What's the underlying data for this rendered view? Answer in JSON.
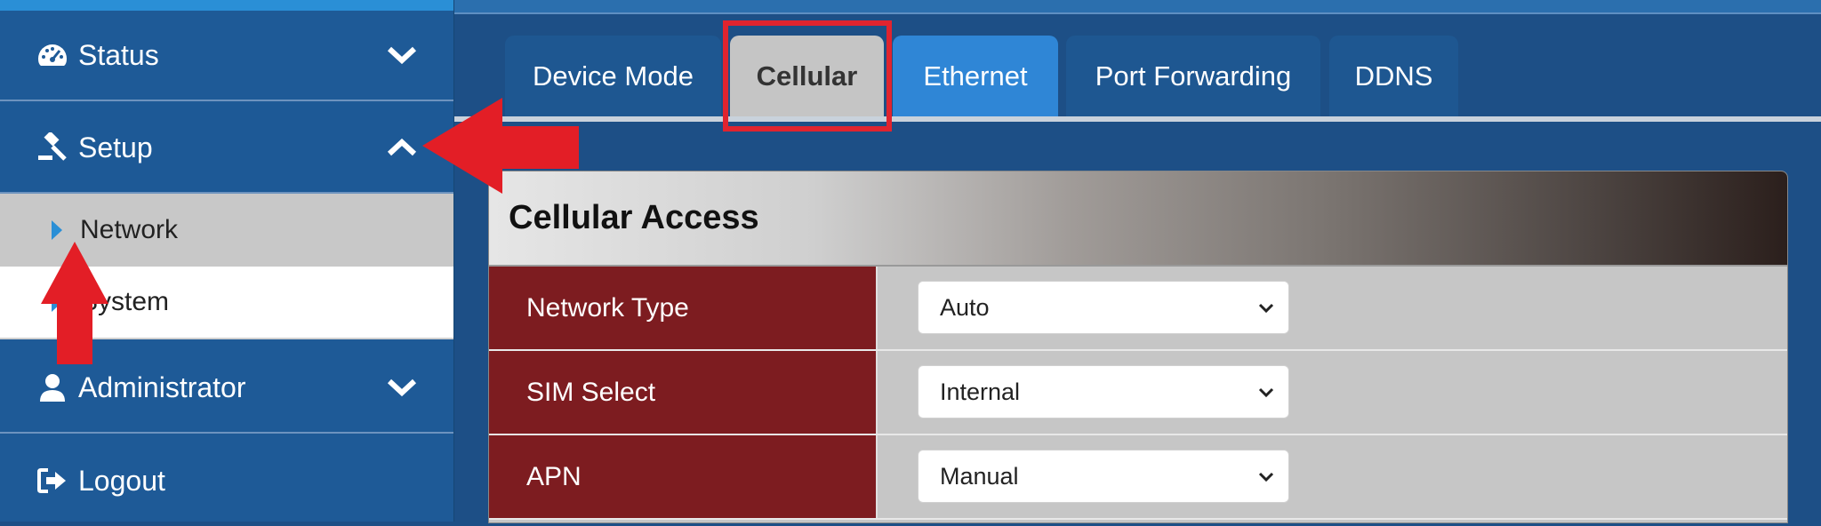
{
  "sidebar": {
    "items": [
      {
        "label": "Status",
        "icon": "dashboard-icon",
        "chevron": "chevron-down-icon"
      },
      {
        "label": "Setup",
        "icon": "gavel-icon",
        "chevron": "chevron-up-icon"
      },
      {
        "label": "Administrator",
        "icon": "user-icon",
        "chevron": "chevron-down-icon"
      },
      {
        "label": "Logout",
        "icon": "sign-out-icon"
      }
    ],
    "submenu": [
      {
        "label": "Network",
        "selected": true
      },
      {
        "label": "System",
        "selected": false
      }
    ]
  },
  "tabs": [
    {
      "label": "Device Mode"
    },
    {
      "label": "Cellular",
      "active": true
    },
    {
      "label": "Ethernet"
    },
    {
      "label": "Port Forwarding"
    },
    {
      "label": "DDNS"
    }
  ],
  "panel": {
    "title": "Cellular Access",
    "rows": [
      {
        "label": "Network Type",
        "value": "Auto"
      },
      {
        "label": "SIM Select",
        "value": "Internal"
      },
      {
        "label": "APN",
        "value": "Manual"
      }
    ]
  },
  "colors": {
    "sidebar": "#1e5a97",
    "tab": "#1e5791",
    "tab_hover": "#2f86d6",
    "tab_active": "#c5c5c5",
    "row_label": "#7d1c20",
    "highlight": "#e0242f"
  }
}
